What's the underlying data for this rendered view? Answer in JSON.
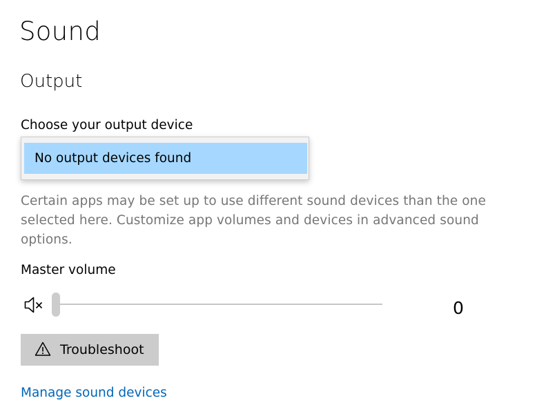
{
  "page": {
    "title": "Sound"
  },
  "output": {
    "section_title": "Output",
    "device_label": "Choose your output device",
    "device_options": [
      "No output devices found"
    ],
    "selected_device": "No output devices found",
    "description": "Certain apps may be set up to use different sound devices than the one selected here. Customize app volumes and devices in advanced sound options.",
    "master_volume_label": "Master volume",
    "volume_icon": "speaker-muted-icon",
    "master_volume_value": "0",
    "master_volume_level": 0,
    "troubleshoot_icon": "warning-icon",
    "troubleshoot_label": "Troubleshoot",
    "manage_devices_link": "Manage sound devices"
  },
  "colors": {
    "highlight": "#a6d8ff",
    "link": "#0067b8",
    "button_background": "#cccccc",
    "description_text": "#767676"
  }
}
